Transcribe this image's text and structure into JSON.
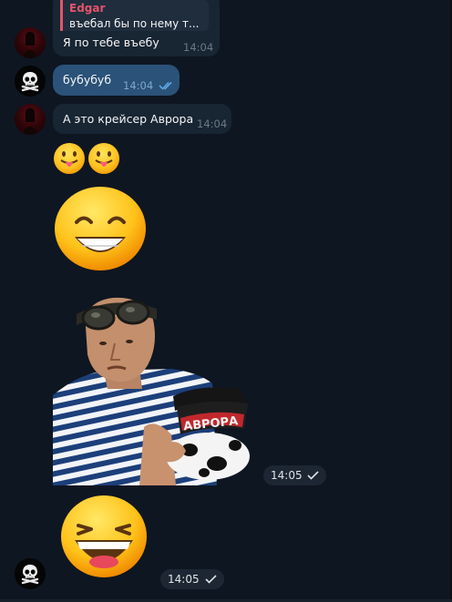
{
  "messages": [
    {
      "sender": "Edgar",
      "reply_to": {
        "name": "Edgar",
        "text": "въебал бы по нему т..."
      },
      "text": "Я по тебе въебу",
      "time": "14:04"
    },
    {
      "sender": "me",
      "text": "бубубуб",
      "time": "14:04",
      "status": "read"
    },
    {
      "sender": "Edgar",
      "text": "А это крейсер Аврора",
      "time": "14:04"
    },
    {
      "sender": "Edgar",
      "type": "emoji",
      "emoji": "😛😛"
    },
    {
      "sender": "Edgar",
      "type": "animated-emoji",
      "emoji": "😁"
    },
    {
      "sender": "Edgar",
      "type": "sticker",
      "caption": "АВРОРА",
      "time": "14:05",
      "status": "sent"
    },
    {
      "sender": "me",
      "type": "animated-emoji",
      "emoji": "😆",
      "time": "14:05",
      "status": "sent"
    }
  ],
  "colors": {
    "background": "#0e1621",
    "incoming_bubble": "#182533",
    "outgoing_bubble": "#2b5278",
    "reply_accent": "#e5546a",
    "read_check": "#5fa7e6"
  },
  "icons": {
    "read_status": "double-check-icon",
    "sent_status": "single-check-icon",
    "avatar_me": "skull-avatar",
    "avatar_edgar": "red-portrait-avatar"
  }
}
